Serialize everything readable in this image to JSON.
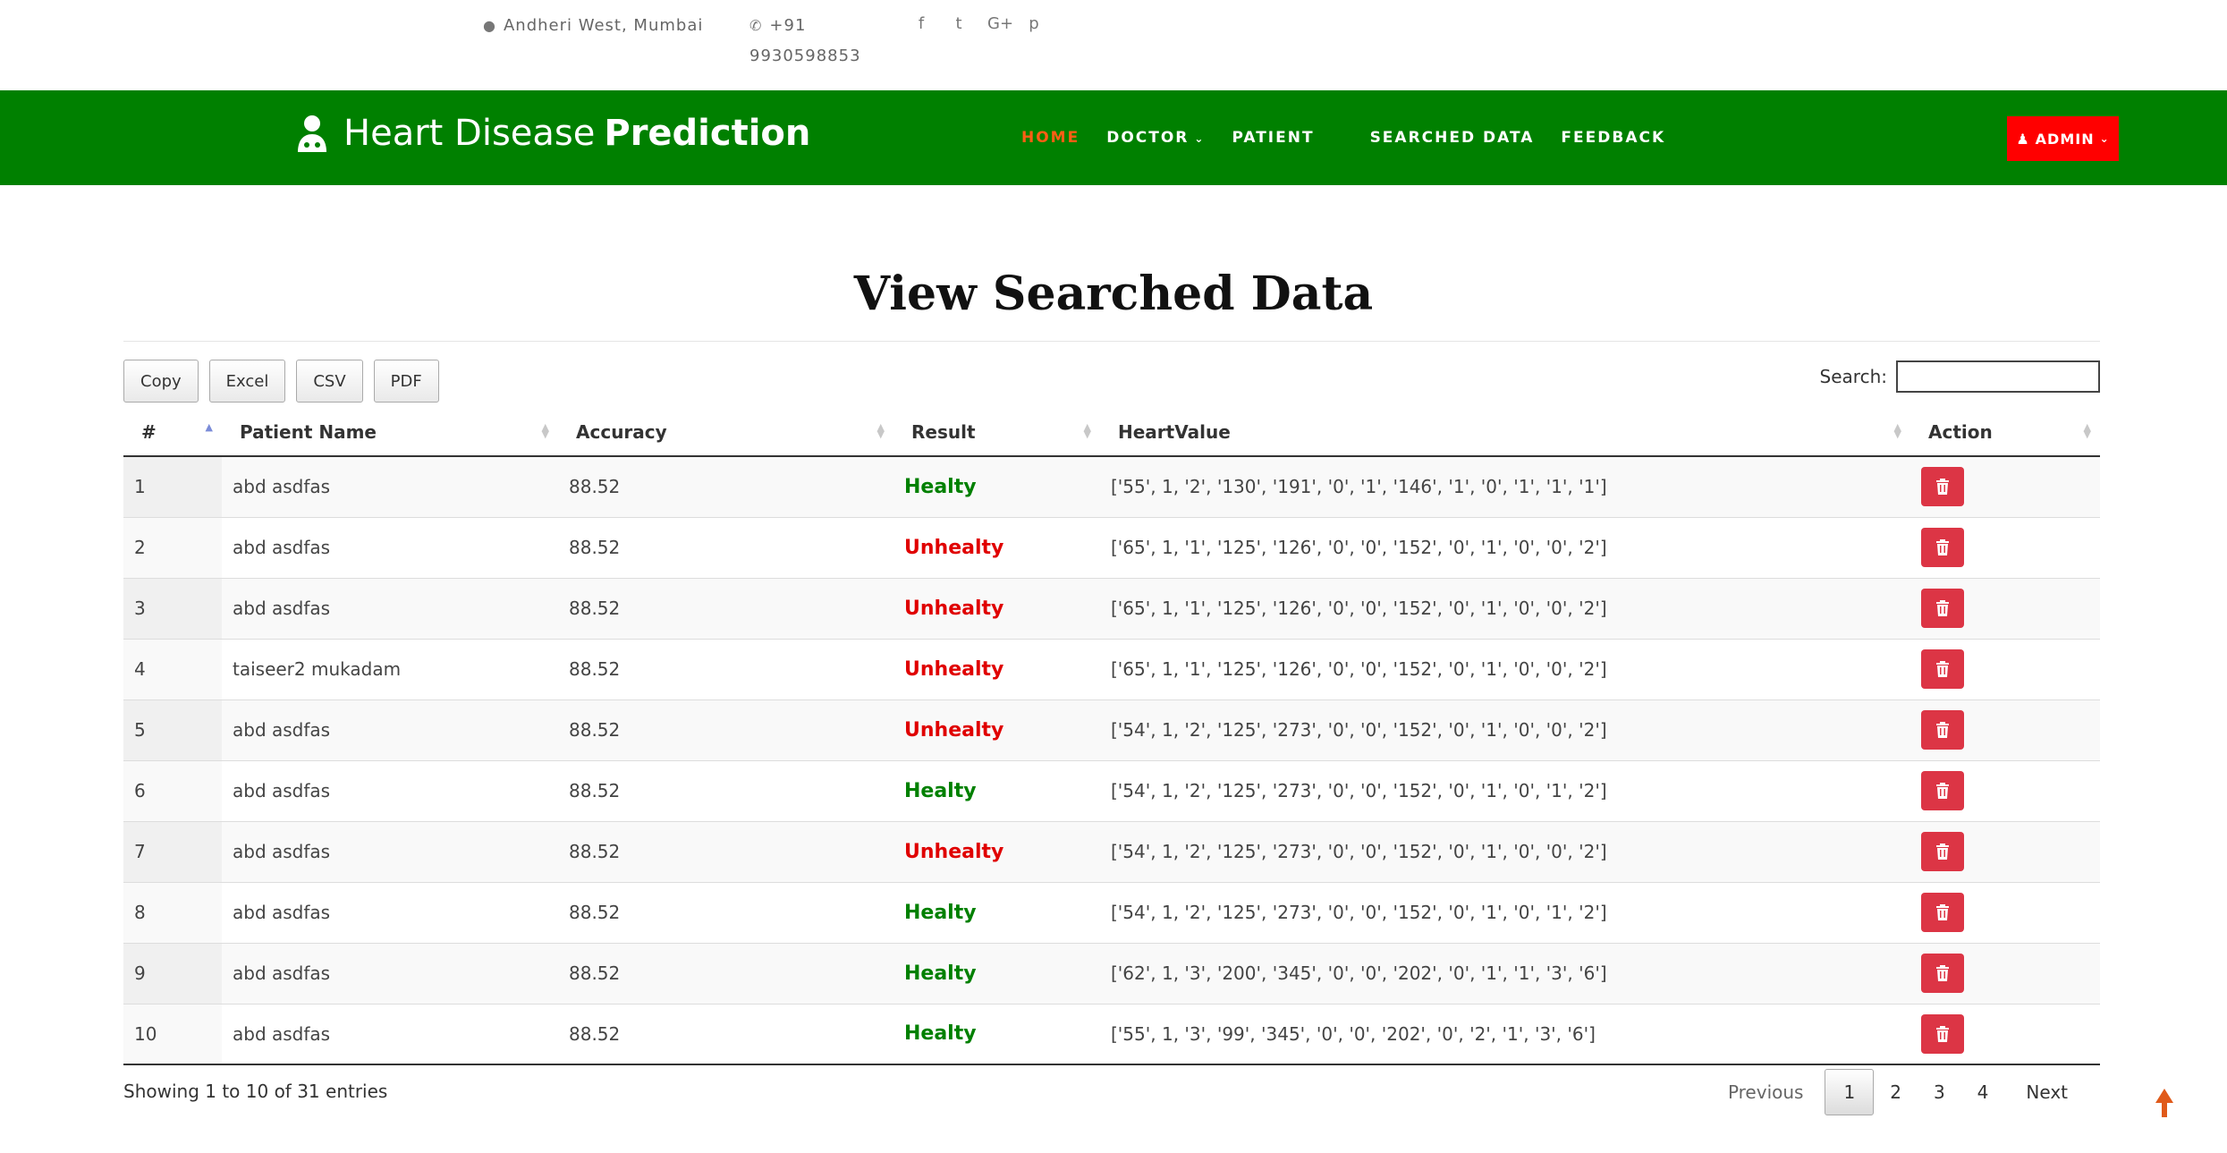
{
  "topbar": {
    "address": "Andheri West, Mumbai",
    "phone_line1": "+91",
    "phone_line2": "9930598853",
    "social_icons": [
      "facebook-icon",
      "twitter-icon",
      "google-plus-icon",
      "pinterest-icon"
    ],
    "social_glyphs": [
      "f",
      "t",
      "G+",
      "p"
    ]
  },
  "navbar": {
    "brand_light": "Heart Disease",
    "brand_bold": "Prediction",
    "links": [
      "HOME",
      "DOCTOR",
      "PATIENT",
      "SEARCHED DATA",
      "FEEDBACK"
    ],
    "admin_label": "ADMIN",
    "bg_color": "#008000",
    "active_color": "#ff5e14",
    "admin_color": "#ff0000"
  },
  "page": {
    "title": "View Searched Data"
  },
  "toolbar": {
    "buttons": [
      "Copy",
      "Excel",
      "CSV",
      "PDF"
    ],
    "search_label": "Search:",
    "search_value": ""
  },
  "table": {
    "headers": [
      "#",
      "Patient Name",
      "Accuracy",
      "Result",
      "HeartValue",
      "Action"
    ],
    "rows": [
      {
        "num": "1",
        "name": "abd asdfas",
        "accuracy": "88.52",
        "result": "Healty",
        "heart": "['55', 1, '2', '130', '191', '0', '1', '146', '1', '0', '1', '1', '1']"
      },
      {
        "num": "2",
        "name": "abd asdfas",
        "accuracy": "88.52",
        "result": "Unhealty",
        "heart": "['65', 1, '1', '125', '126', '0', '0', '152', '0', '1', '0', '0', '2']"
      },
      {
        "num": "3",
        "name": "abd asdfas",
        "accuracy": "88.52",
        "result": "Unhealty",
        "heart": "['65', 1, '1', '125', '126', '0', '0', '152', '0', '1', '0', '0', '2']"
      },
      {
        "num": "4",
        "name": "taiseer2 mukadam",
        "accuracy": "88.52",
        "result": "Unhealty",
        "heart": "['65', 1, '1', '125', '126', '0', '0', '152', '0', '1', '0', '0', '2']"
      },
      {
        "num": "5",
        "name": "abd asdfas",
        "accuracy": "88.52",
        "result": "Unhealty",
        "heart": "['54', 1, '2', '125', '273', '0', '0', '152', '0', '1', '0', '0', '2']"
      },
      {
        "num": "6",
        "name": "abd asdfas",
        "accuracy": "88.52",
        "result": "Healty",
        "heart": "['54', 1, '2', '125', '273', '0', '0', '152', '0', '1', '0', '1', '2']"
      },
      {
        "num": "7",
        "name": "abd asdfas",
        "accuracy": "88.52",
        "result": "Unhealty",
        "heart": "['54', 1, '2', '125', '273', '0', '0', '152', '0', '1', '0', '0', '2']"
      },
      {
        "num": "8",
        "name": "abd asdfas",
        "accuracy": "88.52",
        "result": "Healty",
        "heart": "['54', 1, '2', '125', '273', '0', '0', '152', '0', '1', '0', '1', '2']"
      },
      {
        "num": "9",
        "name": "abd asdfas",
        "accuracy": "88.52",
        "result": "Healty",
        "heart": "['62', 1, '3', '200', '345', '0', '0', '202', '0', '1', '1', '3', '6']"
      },
      {
        "num": "10",
        "name": "abd asdfas",
        "accuracy": "88.52",
        "result": "Healty",
        "heart": "['55', 1, '3', '99', '345', '0', '0', '202', '0', '2', '1', '3', '6']"
      }
    ],
    "result_colors": {
      "Healty": "#008000",
      "Unhealty": "#e00000"
    },
    "delete_color": "#dc3545"
  },
  "footer": {
    "info": "Showing 1 to 10 of 31 entries",
    "previous": "Previous",
    "pages": [
      "1",
      "2",
      "3",
      "4"
    ],
    "current_page": "1",
    "next": "Next"
  }
}
